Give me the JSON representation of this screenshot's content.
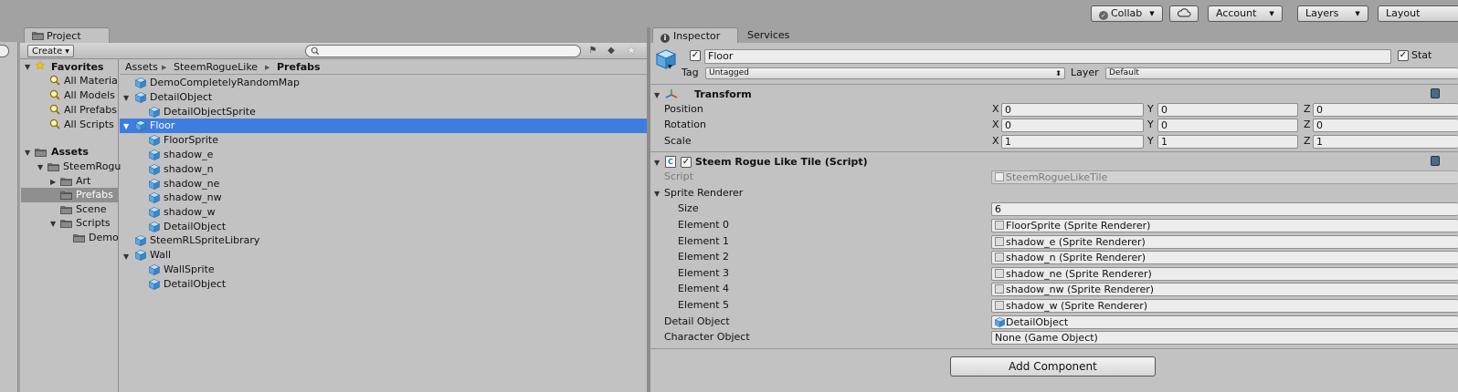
{
  "toolbar": {
    "collab": "Collab",
    "account": "Account",
    "layers": "Layers",
    "layout": "Layout"
  },
  "project": {
    "tab": "Project",
    "create": "Create",
    "search_placeholder": "",
    "favorites": {
      "label": "Favorites",
      "items": [
        "All Materia",
        "All Models",
        "All Prefabs",
        "All Scripts"
      ]
    },
    "assets": {
      "label": "Assets",
      "steem": "SteemRogu",
      "art": "Art",
      "prefabs": "Prefabs",
      "scene": "Scene",
      "scripts": "Scripts",
      "demo": "Demo"
    },
    "breadcrumb": {
      "assets": "Assets",
      "steem": "SteemRogueLike",
      "prefabs": "Prefabs"
    },
    "tree": [
      "DemoCompletelyRandomMap",
      "DetailObject",
      "DetailObjectSprite",
      "Floor",
      "FloorSprite",
      "shadow_e",
      "shadow_n",
      "shadow_ne",
      "shadow_nw",
      "shadow_w",
      "DetailObject",
      "SteemRLSpriteLibrary",
      "Wall",
      "WallSprite",
      "DetailObject"
    ]
  },
  "inspector": {
    "tab": "Inspector",
    "services_tab": "Services",
    "object_name": "Floor",
    "static_label": "Stat",
    "tag_label": "Tag",
    "tag_value": "Untagged",
    "layer_label": "Layer",
    "layer_value": "Default",
    "transform": {
      "title": "Transform",
      "position_label": "Position",
      "rotation_label": "Rotation",
      "scale_label": "Scale",
      "axis": [
        "X",
        "Y",
        "Z"
      ],
      "position": [
        "0",
        "0",
        "0"
      ],
      "rotation": [
        "0",
        "0",
        "0"
      ],
      "scale": [
        "1",
        "1",
        "1"
      ]
    },
    "script_component": {
      "title": "Steem Rogue Like Tile (Script)",
      "script_label": "Script",
      "script_value": "SteemRogueLikeTile",
      "sprite_renderer_label": "Sprite Renderer",
      "size_label": "Size",
      "size_value": "6",
      "elements": [
        {
          "label": "Element 0",
          "value": "FloorSprite (Sprite Renderer)"
        },
        {
          "label": "Element 1",
          "value": "shadow_e (Sprite Renderer)"
        },
        {
          "label": "Element 2",
          "value": "shadow_n (Sprite Renderer)"
        },
        {
          "label": "Element 3",
          "value": "shadow_ne (Sprite Renderer)"
        },
        {
          "label": "Element 4",
          "value": "shadow_nw (Sprite Renderer)"
        },
        {
          "label": "Element 5",
          "value": "shadow_w (Sprite Renderer)"
        }
      ],
      "detail_object_label": "Detail Object",
      "detail_object_value": "DetailObject",
      "character_object_label": "Character Object",
      "character_object_value": "None (Game Object)"
    },
    "add_component": "Add Component"
  },
  "colors": {
    "selection": "#3e7de0",
    "panel": "#c2c2c2",
    "cube": "#5aa9e6"
  }
}
